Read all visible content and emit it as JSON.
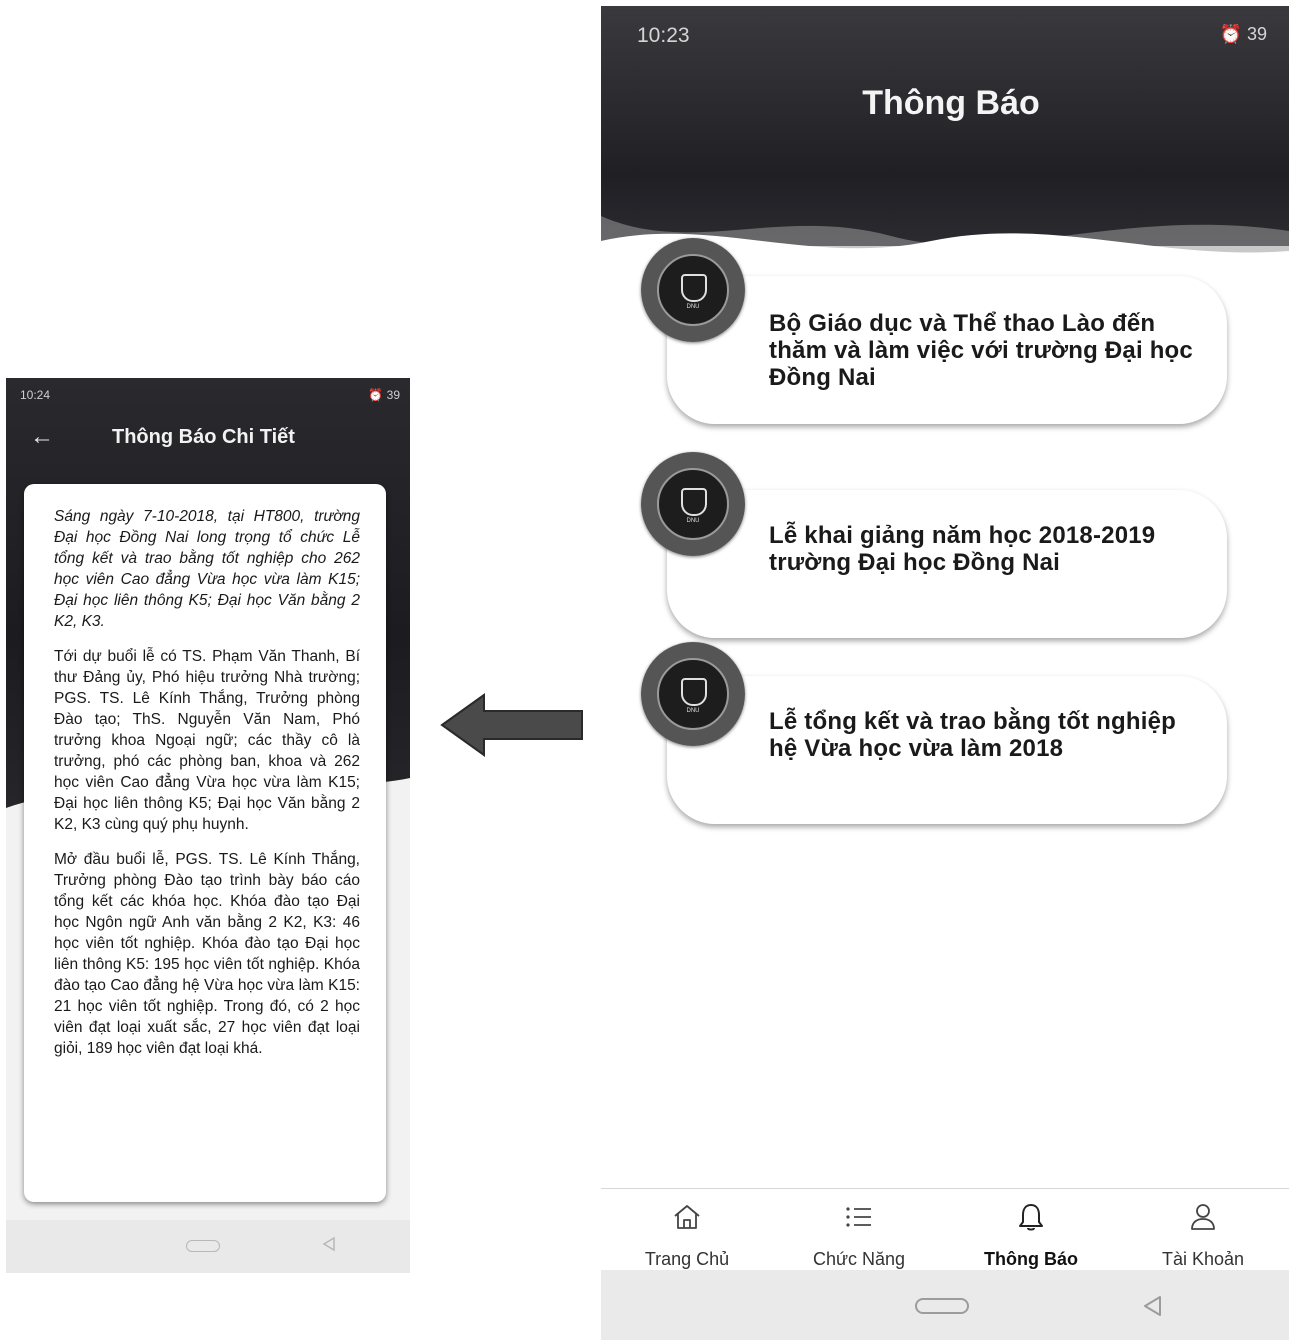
{
  "detail_screen": {
    "status_time": "10:24",
    "status_right": "39",
    "back_glyph": "←",
    "title": "Thông Báo Chi Tiết",
    "paragraphs": [
      "Sáng ngày 7-10-2018, tại HT800, trường Đại học Đồng Nai long trọng tổ chức Lễ tổng kết và trao bằng tốt nghiệp cho 262 học viên Cao đẳng Vừa học vừa làm K15; Đại học liên thông K5; Đại học Văn bằng 2 K2, K3.",
      "Tới dự buổi lễ có TS. Phạm Văn Thanh, Bí thư Đảng ủy, Phó hiệu trưởng Nhà trường; PGS. TS. Lê Kính Thắng, Trưởng phòng Đào tạo; ThS. Nguyễn Văn Nam, Phó trưởng khoa Ngoại ngữ; các thầy cô là trưởng, phó các phòng ban, khoa và 262 học viên Cao đẳng Vừa học vừa làm K15; Đại học liên thông K5; Đại học Văn bằng 2 K2, K3 cùng quý phụ huynh.",
      "Mở đầu buổi lễ, PGS. TS. Lê Kính Thắng, Trưởng phòng Đào tạo trình bày báo cáo tổng kết các khóa học. Khóa đào tạo Đại học Ngôn ngữ Anh văn bằng 2 K2, K3: 46 học viên tốt nghiệp. Khóa đào tạo Đại học liên thông K5: 195 học viên tốt nghiệp. Khóa đào tạo Cao đẳng hệ Vừa học vừa làm K15: 21 học viên tốt nghiệp. Trong đó, có 2 học viên đạt loại xuất sắc, 27 học viên đạt loại giỏi, 189 học viên đạt loại khá."
    ]
  },
  "list_screen": {
    "status_time": "10:23",
    "status_right": "39",
    "title": "Thông Báo",
    "news": [
      {
        "title": "Bộ Giáo dục và Thể thao Lào đến thăm và làm việc với trường Đại học Đồng Nai",
        "logo_text": "DNU"
      },
      {
        "title": "Lễ khai giảng năm học 2018-2019 trường Đại học Đồng Nai",
        "logo_text": "DNU"
      },
      {
        "title": "Lễ tổng kết và trao bằng tốt nghiệp hệ Vừa học vừa làm 2018",
        "logo_text": "DNU"
      }
    ],
    "tabs": [
      {
        "label": "Trang Chủ",
        "icon": "home-icon"
      },
      {
        "label": "Chức Năng",
        "icon": "list-icon"
      },
      {
        "label": "Thông Báo",
        "icon": "bell-icon",
        "active": true
      },
      {
        "label": "Tài Khoản",
        "icon": "user-icon"
      }
    ]
  },
  "colors": {
    "header_dark": "#1f1f24",
    "card_bg": "#ffffff",
    "nav_bg": "#eaeaea"
  }
}
